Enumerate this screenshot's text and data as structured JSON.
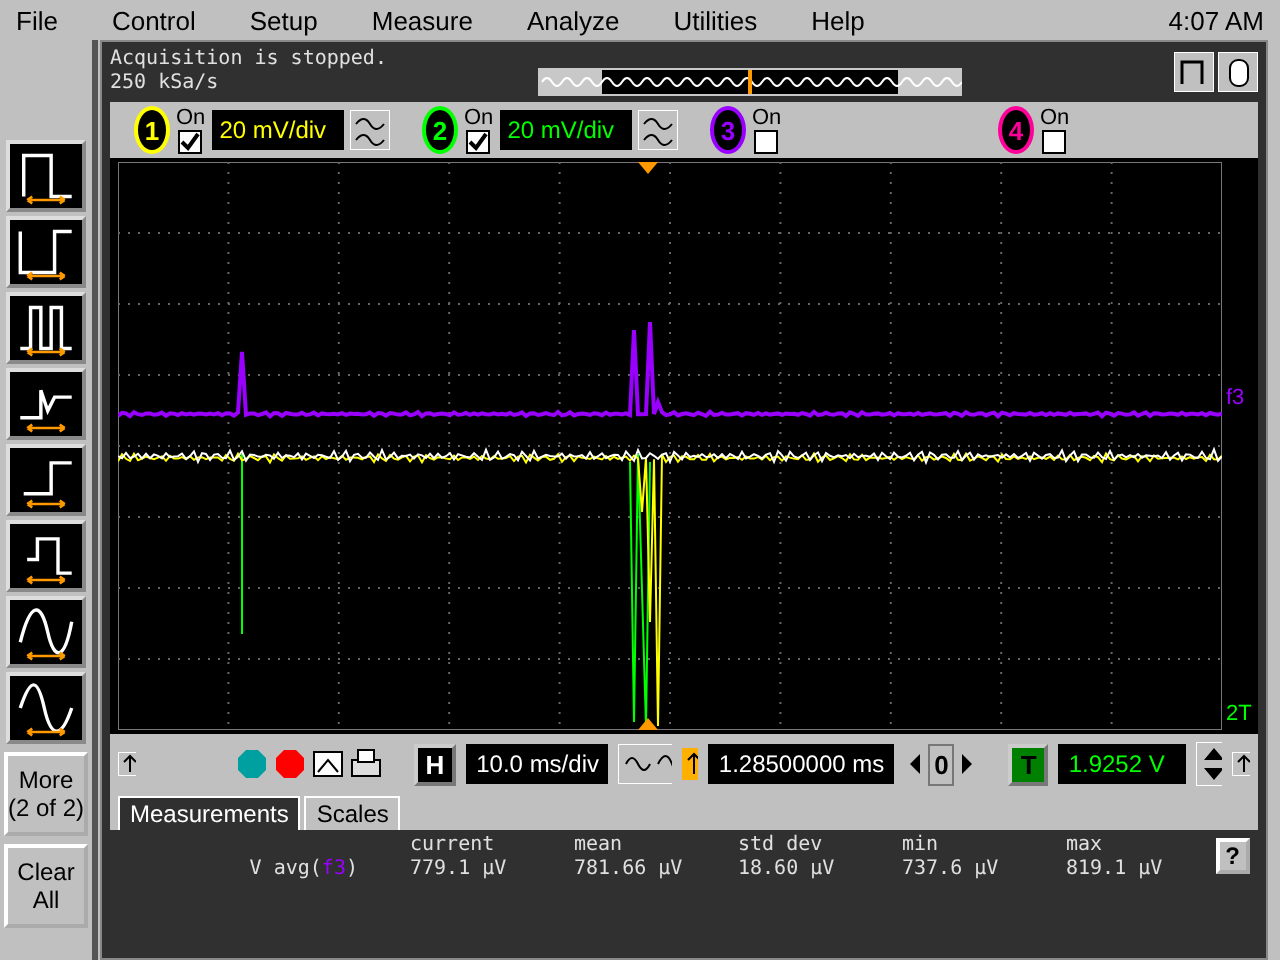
{
  "menu": [
    "File",
    "Control",
    "Setup",
    "Measure",
    "Analyze",
    "Utilities",
    "Help"
  ],
  "clock": "4:07 AM",
  "status": [
    "Acquisition is stopped.",
    "250 kSa/s"
  ],
  "channels": [
    {
      "number": "1",
      "color": "#ffff00",
      "on": true,
      "on_label": "On",
      "scale": "20 mV/div"
    },
    {
      "number": "2",
      "color": "#00ff00",
      "on": true,
      "on_label": "On",
      "scale": "20 mV/div"
    },
    {
      "number": "3",
      "color": "#9900ff",
      "on": false,
      "on_label": "On"
    },
    {
      "number": "4",
      "color": "#ff0099",
      "on": false,
      "on_label": "On"
    }
  ],
  "side_buttons": [
    {
      "label": "More (2 of 2)"
    },
    {
      "label": "Clear All"
    }
  ],
  "timebase": {
    "h_label": "H",
    "scale": "10.0 ms/div",
    "delay": "1.28500000 ms",
    "reference": "0"
  },
  "trigger": {
    "t_label": "T",
    "level": "1.9252 V"
  },
  "marker_labels": {
    "f3": "f3",
    "t": "T",
    "two": "2"
  },
  "tabs": [
    {
      "label": "Measurements",
      "selected": true
    },
    {
      "label": "Scales",
      "selected": false
    }
  ],
  "measurements": {
    "columns": [
      "current",
      "mean",
      "std dev",
      "min",
      "max"
    ],
    "rows": [
      {
        "prefix": "V avg(",
        "source": "f3",
        "suffix": ")",
        "values": [
          "779.1 µV",
          "781.66 µV",
          "18.60 µV",
          "737.6 µV",
          "819.1 µV"
        ]
      }
    ]
  },
  "help": "?"
}
